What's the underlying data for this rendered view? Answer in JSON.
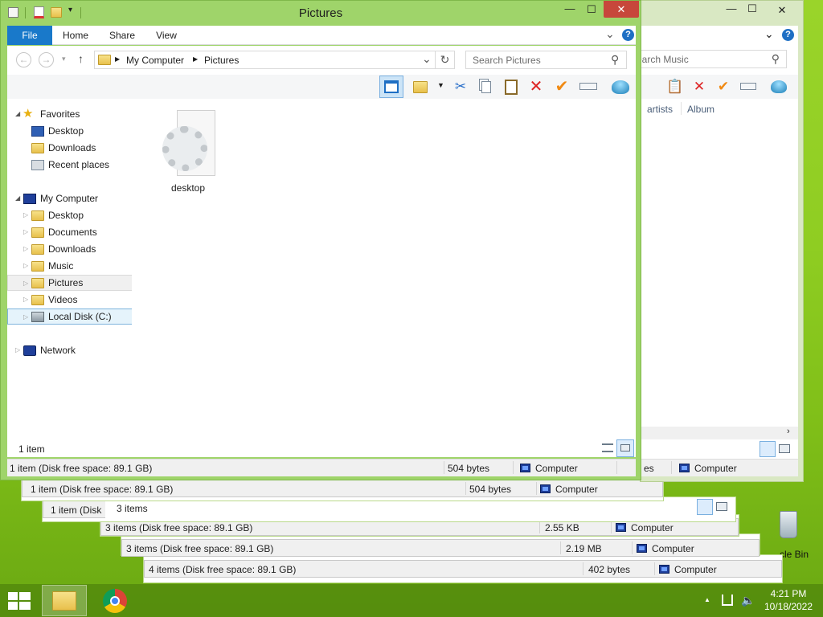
{
  "window": {
    "title": "Pictures",
    "minimize_glyph": "—",
    "maximize_glyph": "☐",
    "close_glyph": "✕"
  },
  "ribbon": {
    "tabs": [
      "File",
      "Home",
      "Share",
      "View"
    ],
    "expand_glyph": "⌄",
    "help_glyph": "?"
  },
  "address": {
    "back_glyph": "←",
    "forward_glyph": "→",
    "up_glyph": "↑",
    "crumb_root": "My Computer",
    "crumb_current": "Pictures",
    "dropdown_glyph": "⌄",
    "refresh_glyph": "↻",
    "search_placeholder": "Search Pictures",
    "search_glyph": "⚲"
  },
  "toolbar": {
    "icons": [
      "layout-pane-icon",
      "new-folder-icon",
      "cut-icon",
      "copy-icon",
      "paste-icon",
      "delete-icon",
      "checkmark-icon",
      "rename-icon",
      "shell-icon"
    ]
  },
  "navigation": {
    "favorites_label": "Favorites",
    "favorites": [
      "Desktop",
      "Downloads",
      "Recent places"
    ],
    "computer_label": "My Computer",
    "computer_items": [
      "Desktop",
      "Documents",
      "Downloads",
      "Music",
      "Pictures",
      "Videos",
      "Local Disk (C:)"
    ],
    "network_label": "Network"
  },
  "content": {
    "file_name": "desktop"
  },
  "status": {
    "item_count": "1 item",
    "summary": "1 item (Disk free space: 89.1 GB)",
    "size": "504 bytes",
    "location": "Computer"
  },
  "music_window": {
    "search_placeholder": "Search Music",
    "col_artists": "artists",
    "col_album": "Album",
    "status_tail": "es",
    "location": "Computer"
  },
  "stacked_windows": [
    {
      "summary": "1 item (Disk free space: 89.1 GB)",
      "size": "504 bytes",
      "location": "Computer"
    },
    {
      "summary": "1 item (Disk",
      "count": "3 items"
    },
    {
      "summary": "3 items (Disk free space: 89.1 GB)",
      "size": "2.55 KB",
      "location": "Computer"
    },
    {
      "summary": "3 items (Disk free space: 89.1 GB)",
      "size": "2.19 MB",
      "location": "Computer"
    },
    {
      "summary": "4 items (Disk free space: 89.1 GB)",
      "size": "402 bytes",
      "location": "Computer"
    }
  ],
  "desktop": {
    "recycle_label": "cle Bin"
  },
  "taskbar": {
    "time": "4:21 PM",
    "date": "10/18/2022",
    "tray_up_glyph": "▲"
  }
}
